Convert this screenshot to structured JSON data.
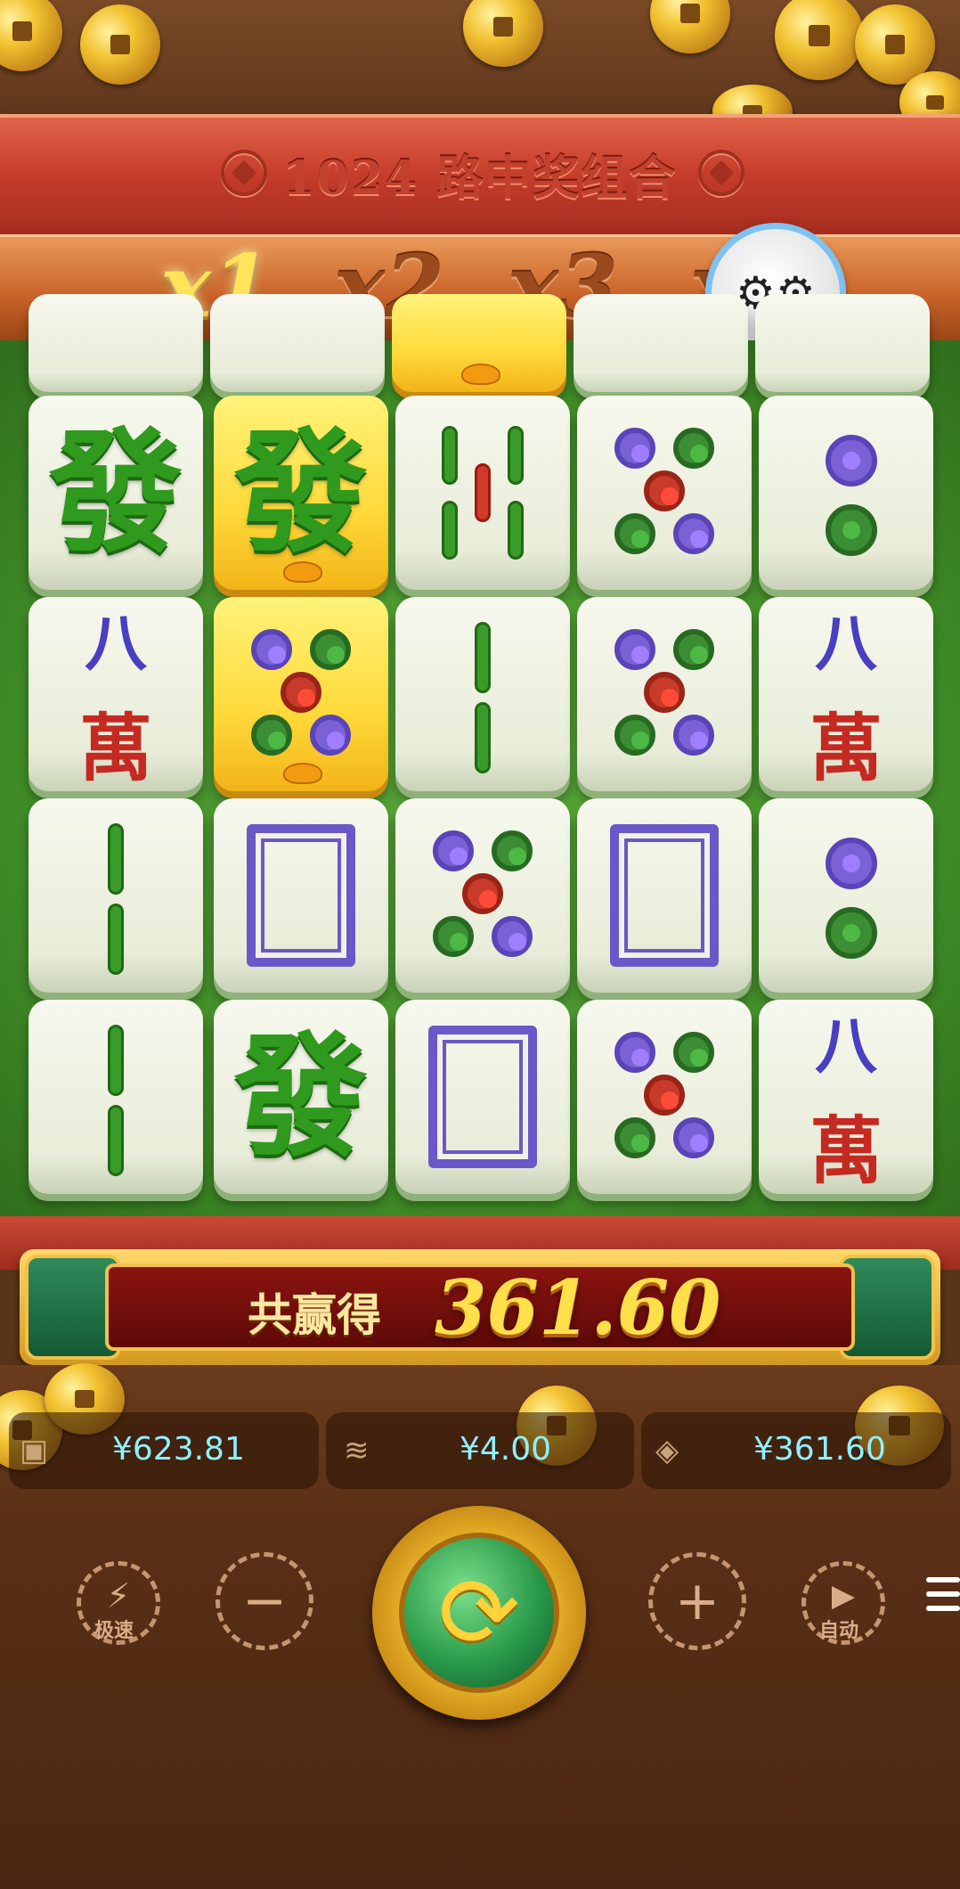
{
  "ways_banner": {
    "text": "1024 路中奖组合"
  },
  "multipliers": [
    {
      "label": "x1",
      "active": true
    },
    {
      "label": "x2",
      "active": false
    },
    {
      "label": "x3",
      "active": false
    },
    {
      "label": "x",
      "active": false
    }
  ],
  "settings": {
    "icon": "gears-icon"
  },
  "win": {
    "label": "共赢得",
    "amount": "361.60"
  },
  "stats": {
    "balance": {
      "icon": "wallet-icon",
      "value": "¥623.81"
    },
    "bet": {
      "icon": "coin-stack-icon",
      "value": "¥4.00"
    },
    "win": {
      "icon": "prize-icon",
      "value": "¥361.60"
    }
  },
  "controls": {
    "turbo_label": "极速",
    "auto_label": "自动"
  },
  "tiles": {
    "fa": "發",
    "eight": "八",
    "wan": "萬"
  }
}
